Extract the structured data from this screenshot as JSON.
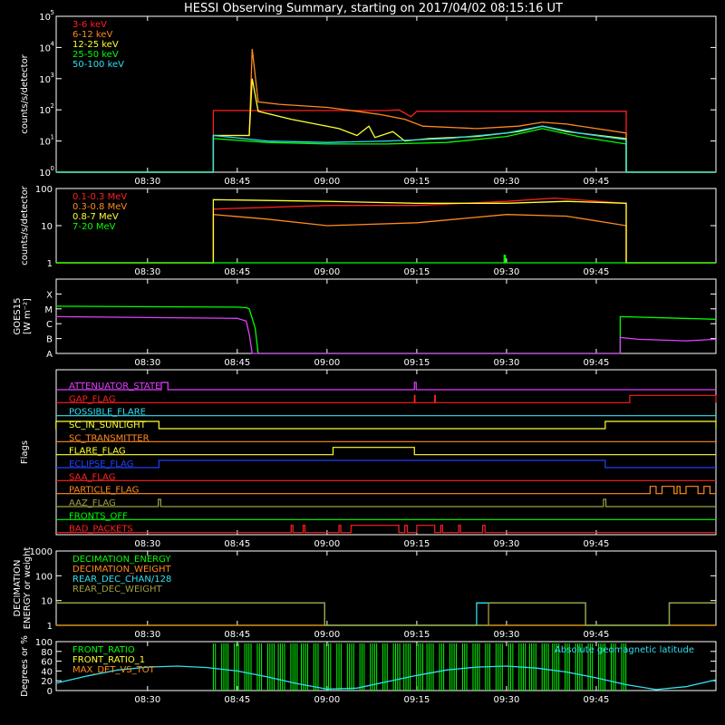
{
  "title": "HESSI Observing Summary, starting on 2017/04/02 08:15:16 UT",
  "colors": {
    "red": "#ff2020",
    "orange": "#ff8a1e",
    "yellow": "#ffff30",
    "green": "#00ff00",
    "cyan": "#30e0f0",
    "magenta": "#e040ff",
    "blue": "#2040ff",
    "olive": "#a0a040",
    "white": "#ffffff"
  },
  "time_ticks": [
    "08:30",
    "08:45",
    "09:00",
    "09:15",
    "09:30",
    "09:45"
  ],
  "chart_data": [
    {
      "type": "line",
      "name": "panel1",
      "ylabel": "counts/s/detector",
      "ylog": true,
      "ylim": [
        1,
        100000
      ],
      "yticks": [
        {
          "v": 1,
          "base": "10",
          "exp": "0"
        },
        {
          "v": 10,
          "base": "10",
          "exp": "1"
        },
        {
          "v": 100,
          "base": "10",
          "exp": "2"
        },
        {
          "v": 1000,
          "base": "10",
          "exp": "3"
        },
        {
          "v": 10000,
          "base": "10",
          "exp": "4"
        },
        {
          "v": 100000,
          "base": "10",
          "exp": "5"
        }
      ],
      "xlim_min": [
        -15.27,
        95
      ],
      "series": [
        {
          "name": "3-6 keV",
          "color": "#ff2020",
          "x": [
            -15.3,
            11.0,
            11.0,
            40,
            42,
            44,
            45,
            80,
            80,
            95
          ],
          "y": [
            1,
            1,
            95,
            95,
            100,
            60,
            90,
            90,
            1,
            1
          ]
        },
        {
          "name": "6-12 keV",
          "color": "#ff8a1e",
          "x": [
            -15.3,
            11.0,
            11.0,
            17.0,
            17.5,
            18.5,
            22,
            30,
            35,
            39,
            43,
            46,
            55,
            62,
            66,
            70,
            80,
            80,
            95
          ],
          "y": [
            1,
            1,
            15,
            15,
            9000,
            180,
            150,
            120,
            90,
            70,
            50,
            30,
            25,
            30,
            40,
            35,
            18,
            1,
            1
          ]
        },
        {
          "name": "12-25 keV",
          "color": "#ffff30",
          "x": [
            -15.3,
            11.0,
            11.0,
            17.0,
            17.5,
            18.5,
            24,
            32,
            35,
            37,
            38,
            41,
            43,
            47,
            55,
            62,
            66,
            70,
            80,
            80,
            95
          ],
          "y": [
            1,
            1,
            15,
            15,
            1000,
            90,
            50,
            25,
            15,
            30,
            13,
            20,
            10,
            12,
            14,
            20,
            30,
            20,
            12,
            1,
            1
          ]
        },
        {
          "name": "25-50 keV",
          "color": "#00ff00",
          "x": [
            -15.3,
            11.0,
            11.0,
            20,
            30,
            40,
            50,
            60,
            66,
            72,
            80,
            80,
            95
          ],
          "y": [
            1,
            1,
            12,
            9,
            8,
            8,
            9,
            14,
            25,
            14,
            8,
            1,
            1
          ]
        },
        {
          "name": "50-100 keV",
          "color": "#30e0f0",
          "x": [
            -15.3,
            11.0,
            11.0,
            20,
            30,
            40,
            50,
            60,
            66,
            72,
            80,
            80,
            95
          ],
          "y": [
            1,
            1,
            15,
            10,
            9,
            10,
            12,
            18,
            30,
            18,
            11,
            1,
            1
          ]
        }
      ]
    },
    {
      "type": "line",
      "name": "panel2",
      "ylabel": "counts/s/detector",
      "ylog": true,
      "ylim": [
        1,
        100
      ],
      "yticks": [
        {
          "v": 1,
          "label": "1"
        },
        {
          "v": 10,
          "label": "10"
        },
        {
          "v": 100,
          "label": "100"
        }
      ],
      "series": [
        {
          "name": "0.1-0.3 MeV",
          "color": "#ff2020",
          "x": [
            -15.3,
            11.0,
            11.0,
            30,
            45,
            60,
            68,
            80,
            80,
            95
          ],
          "y": [
            1,
            1,
            28,
            35,
            35,
            45,
            55,
            40,
            1,
            1
          ]
        },
        {
          "name": "0.3-0.8 MeV",
          "color": "#ff8a1e",
          "x": [
            -15.3,
            11.0,
            11.0,
            20,
            30,
            45,
            60,
            70,
            80,
            80,
            95
          ],
          "y": [
            1,
            1,
            20,
            15,
            10,
            12,
            20,
            18,
            10,
            1,
            1
          ]
        },
        {
          "name": "0.8-7 MeV",
          "color": "#ffff30",
          "x": [
            -15.3,
            11.0,
            11.0,
            30,
            45,
            60,
            70,
            80,
            80,
            95
          ],
          "y": [
            1,
            1,
            50,
            45,
            40,
            40,
            45,
            40,
            1,
            1
          ]
        },
        {
          "name": "7-20 MeV",
          "color": "#00ff00",
          "x": [
            -15.3,
            59.6,
            59.6,
            59.8,
            59.8,
            95
          ],
          "y": [
            1,
            1,
            1.6,
            1.6,
            1,
            1
          ]
        }
      ]
    },
    {
      "type": "line",
      "name": "panel3",
      "ylabel": "GOES15",
      "ylabel2": "[W m⁻²]",
      "ylog": true,
      "ylim": [
        1e-08,
        0.001
      ],
      "yticks": [
        {
          "v": 1e-08,
          "label": "A"
        },
        {
          "v": 1e-07,
          "label": "B"
        },
        {
          "v": 1e-06,
          "label": "C"
        },
        {
          "v": 1e-05,
          "label": "M"
        },
        {
          "v": 0.0001,
          "label": "X"
        }
      ],
      "series": [
        {
          "name": "goes-long",
          "color": "#00ff00",
          "x": [
            -15.3,
            15,
            16.5,
            17,
            18,
            18.5,
            79,
            79,
            95
          ],
          "y": [
            1.5e-05,
            1.3e-05,
            1.2e-05,
            1e-05,
            5e-07,
            1e-08,
            1e-08,
            3e-06,
            2e-06
          ]
        },
        {
          "name": "goes-short",
          "color": "#e040ff",
          "x": [
            -15.3,
            15,
            16.5,
            17,
            17.5,
            79,
            79,
            82,
            90,
            95
          ],
          "y": [
            3e-06,
            2.3e-06,
            1.5e-06,
            2e-07,
            1e-08,
            1e-08,
            1.2e-07,
            9e-08,
            7e-08,
            9e-08
          ]
        }
      ]
    },
    {
      "type": "line",
      "name": "panel4",
      "ylabel": "Flags",
      "flags": [
        {
          "label": "ATTENUATOR_STATE",
          "color": "#e040ff",
          "high": [
            [
              2.3,
              3.4
            ],
            [
              44.6,
              44.9
            ]
          ]
        },
        {
          "label": "GAP_FLAG",
          "color": "#ff2020",
          "high": [
            [
              44.6,
              44.7
            ],
            [
              48.0,
              48.1
            ],
            [
              80.6,
              95
            ]
          ]
        },
        {
          "label": "POSSIBLE_FLARE",
          "color": "#30e0f0",
          "high": []
        },
        {
          "label": "SC_IN_SUNLIGHT",
          "color": "#ffff30",
          "high": [
            [
              -15.3,
              1.9
            ],
            [
              76.5,
              95
            ]
          ]
        },
        {
          "label": "SC_TRANSMITTER",
          "color": "#ff8a1e",
          "high": []
        },
        {
          "label": "FLARE_FLAG",
          "color": "#ffff30",
          "high": [
            [
              31.0,
              44.6
            ]
          ]
        },
        {
          "label": "ECLIPSE_FLAG",
          "color": "#2040ff",
          "high": [
            [
              1.9,
              76.5
            ]
          ]
        },
        {
          "label": "SAA_FLAG",
          "color": "#ff2020",
          "high": []
        },
        {
          "label": "PARTICLE_FLAG",
          "color": "#ff8a1e",
          "high": [
            [
              84.0,
              85.0
            ],
            [
              86.0,
              88.0
            ],
            [
              88.5,
              89.0
            ],
            [
              90.0,
              92.0
            ],
            [
              93.0,
              94.0
            ]
          ]
        },
        {
          "label": "AAZ_FLAG",
          "color": "#a0a040",
          "high": [
            [
              1.8,
              2.2
            ],
            [
              76.2,
              76.6
            ]
          ]
        },
        {
          "label": "FRONTS_OFF",
          "color": "#00ff00",
          "high": []
        },
        {
          "label": "BAD_PACKETS",
          "color": "#ff2020",
          "high": [
            [
              24,
              24.3
            ],
            [
              26,
              26.3
            ],
            [
              32,
              32.3
            ],
            [
              34,
              42
            ],
            [
              43,
              43.4
            ],
            [
              45,
              48
            ],
            [
              49,
              49.3
            ],
            [
              52,
              52.3
            ],
            [
              56,
              56.4
            ]
          ]
        }
      ]
    },
    {
      "type": "line",
      "name": "panel5",
      "ylabel": "DECIMATION",
      "ylabel2": "ENERGY or weight",
      "ylog": true,
      "ylim": [
        1,
        1000
      ],
      "yticks": [
        {
          "v": 1,
          "label": "1"
        },
        {
          "v": 10,
          "label": "10"
        },
        {
          "v": 100,
          "label": "100"
        },
        {
          "v": 1000,
          "label": "1000"
        }
      ],
      "series": [
        {
          "name": "DECIMATION_ENERGY",
          "color": "#00ff00",
          "x": [
            -15.3,
            95
          ],
          "y": [
            1,
            1
          ]
        },
        {
          "name": "DECIMATION_WEIGHT",
          "color": "#ff8a1e",
          "x": [
            -15.3,
            95
          ],
          "y": [
            1,
            1
          ]
        },
        {
          "name": "REAR_DEC_CHAN/128",
          "color": "#30e0f0",
          "x": [
            -15.3,
            29.6,
            29.6,
            55.0,
            55.0,
            57.0,
            57.0,
            73.2,
            73.2,
            87.2,
            87.2,
            95
          ],
          "y": [
            8,
            8,
            1,
            1,
            8,
            8,
            8,
            8,
            1,
            1,
            8,
            8
          ]
        },
        {
          "name": "REAR_DEC_WEIGHT",
          "color": "#a0a040",
          "x": [
            -15.3,
            29.6,
            29.6,
            55.0,
            55.0,
            57.0,
            57.0,
            73.2,
            73.2,
            87.2,
            87.2,
            95
          ],
          "y": [
            8,
            8,
            1,
            1,
            1,
            1,
            8,
            8,
            1,
            1,
            8,
            8
          ]
        }
      ]
    },
    {
      "type": "line",
      "name": "panel6",
      "ylabel": "Degrees or %",
      "ylog": false,
      "ylim": [
        0,
        100
      ],
      "yticks": [
        {
          "v": 0,
          "label": "0"
        },
        {
          "v": 20,
          "label": "20"
        },
        {
          "v": 40,
          "label": "40"
        },
        {
          "v": 60,
          "label": "60"
        },
        {
          "v": 80,
          "label": "80"
        },
        {
          "v": 100,
          "label": "100"
        }
      ],
      "annotation": "Absolute geomagnetic latitude",
      "series": [
        {
          "name": "FRONT_RATIO",
          "color": "#00ff00"
        },
        {
          "name": "FRONT_RATIO_1",
          "color": "#ffff30"
        },
        {
          "name": "MAX_DET_VS_TOT",
          "color": "#ff8a1e"
        },
        {
          "name": "latitude",
          "color": "#30e0f0",
          "x": [
            -15.3,
            -10,
            -5,
            0,
            5,
            10,
            15,
            20,
            25,
            30,
            35,
            40,
            45,
            50,
            55,
            60,
            65,
            70,
            75,
            80,
            85,
            90,
            95
          ],
          "y": [
            15,
            30,
            42,
            48,
            50,
            47,
            40,
            28,
            14,
            3,
            5,
            18,
            31,
            42,
            48,
            50,
            46,
            38,
            26,
            12,
            2,
            8,
            22
          ]
        }
      ],
      "green_band_x": [
        11.0,
        80.0
      ]
    }
  ]
}
